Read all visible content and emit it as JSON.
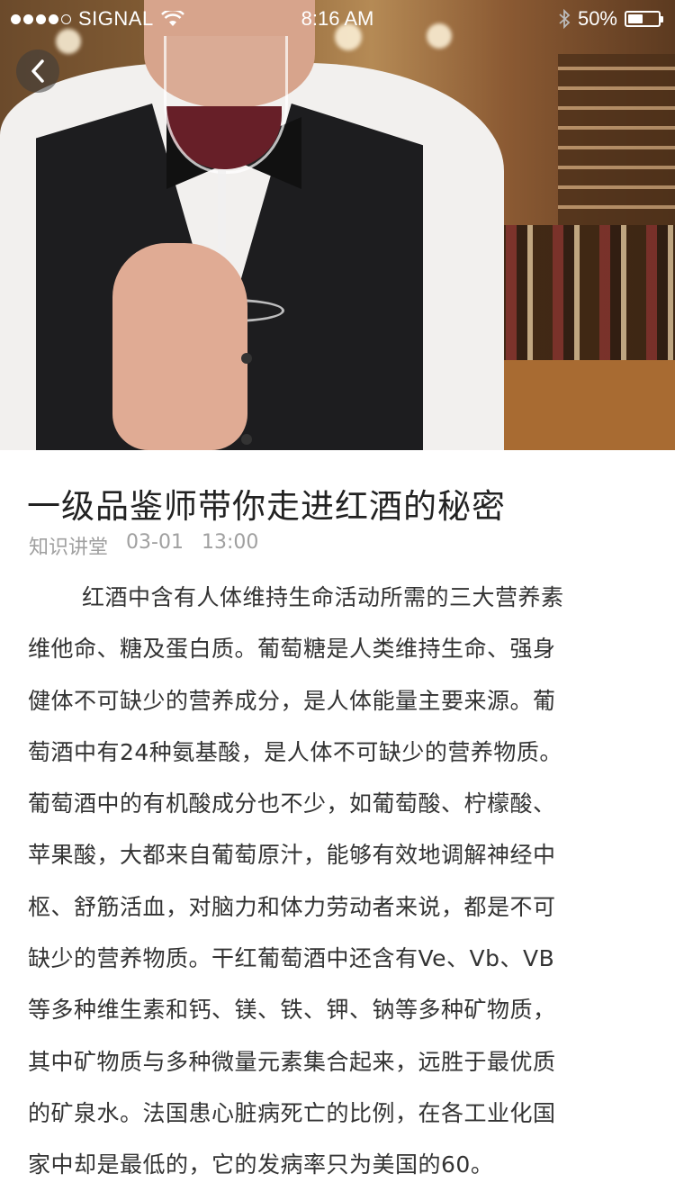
{
  "status_bar": {
    "carrier": "SIGNAL",
    "time": "8:16 AM",
    "battery_percent": "50%",
    "battery_level": 0.5,
    "signal_bars_filled": 4,
    "signal_bars_total": 5
  },
  "hero": {
    "image_icon": "sommelier-with-red-wine-photo",
    "back_icon": "chevron-left-icon"
  },
  "article": {
    "title": "一级品鉴师带你走进红酒的秘密",
    "category": "知识讲堂",
    "date": "03-01",
    "time": "13:00",
    "lines": [
      "红酒中含有人体维持生命活动所需的三大营养素",
      "维他命、糖及蛋白质。葡萄糖是人类维持生命、强身",
      "健体不可缺少的营养成分，是人体能量主要来源。葡",
      "萄酒中有24种氨基酸，是人体不可缺少的营养物质。",
      "葡萄酒中的有机酸成分也不少，如葡萄酸、柠檬酸、",
      "苹果酸，大都来自葡萄原汁，能够有效地调解神经中",
      "枢、舒筋活血，对脑力和体力劳动者来说，都是不可",
      "缺少的营养物质。干红葡萄酒中还含有Ve、Vb、VB",
      "等多种维生素和钙、镁、铁、钾、钠等多种矿物质，",
      "其中矿物质与多种微量元素集合起来，远胜于最优质",
      "的矿泉水。法国患心脏病死亡的比例，在各工业化国",
      "家中却是最低的，它的发病率只为美国的60。"
    ]
  }
}
